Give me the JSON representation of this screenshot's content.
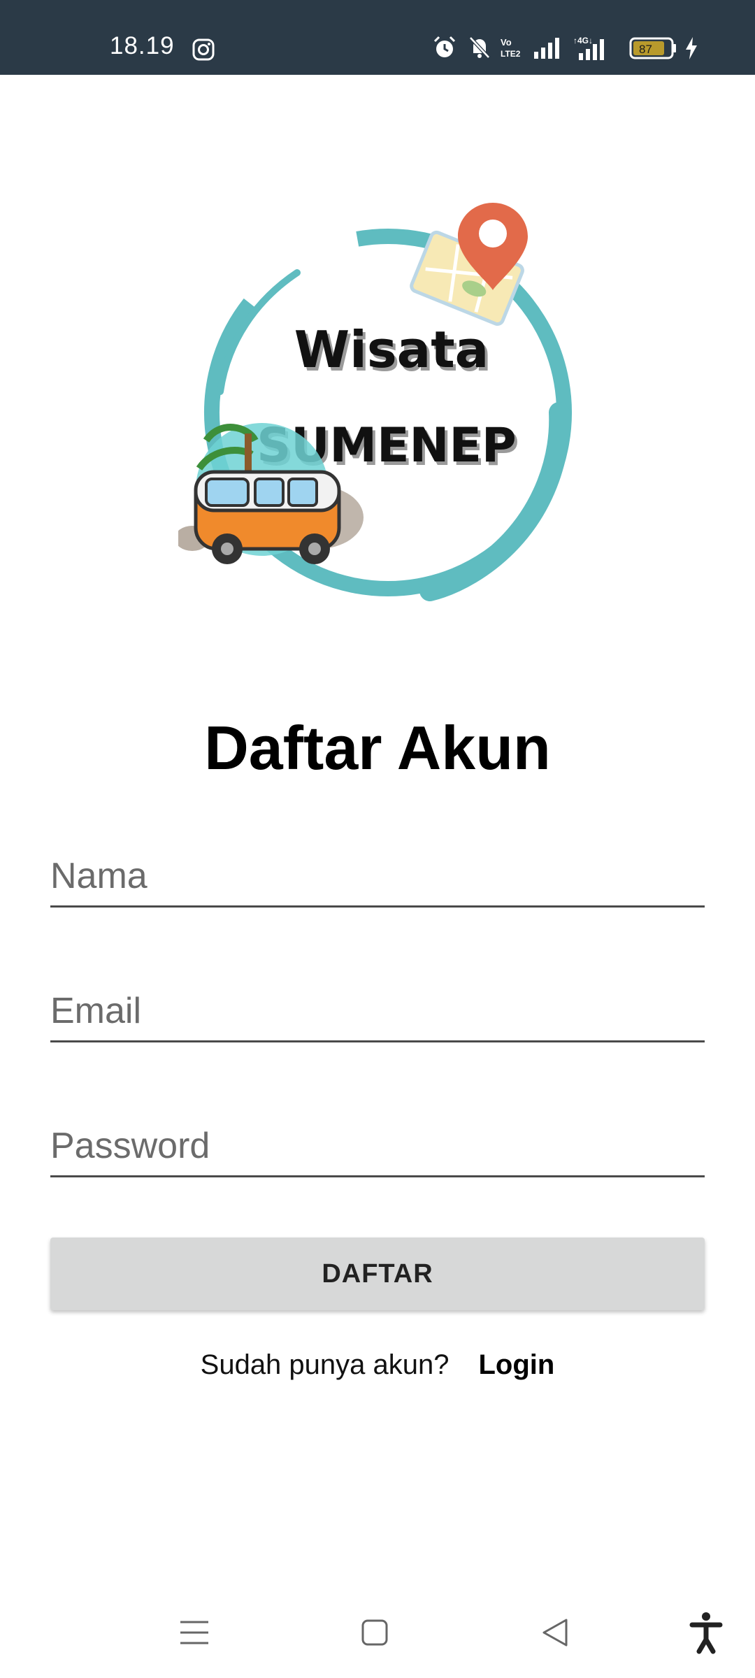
{
  "status_bar": {
    "time": "18.19",
    "battery": "87",
    "network": "4G",
    "volte": "Vo LTE2",
    "icons": [
      "instagram-icon",
      "alarm-icon",
      "mute-icon",
      "volte-icon",
      "signal-icon",
      "4g-signal-icon",
      "battery-icon",
      "charging-icon"
    ]
  },
  "logo": {
    "line1": "Wisata",
    "line2": "SUMENEP"
  },
  "form": {
    "title": "Daftar Akun",
    "name_placeholder": "Nama",
    "email_placeholder": "Email",
    "password_placeholder": "Password",
    "submit_label": "DAFTAR"
  },
  "footer": {
    "question": "Sudah punya akun?",
    "login_link": "Login"
  },
  "nav": {
    "icons": [
      "menu-icon",
      "home-icon",
      "back-icon",
      "accessibility-icon"
    ]
  },
  "colors": {
    "statusbar": "#2b3a47",
    "button": "#d7d8d8",
    "logo_ring": "#5fbcc0",
    "van": "#f08a2c"
  }
}
